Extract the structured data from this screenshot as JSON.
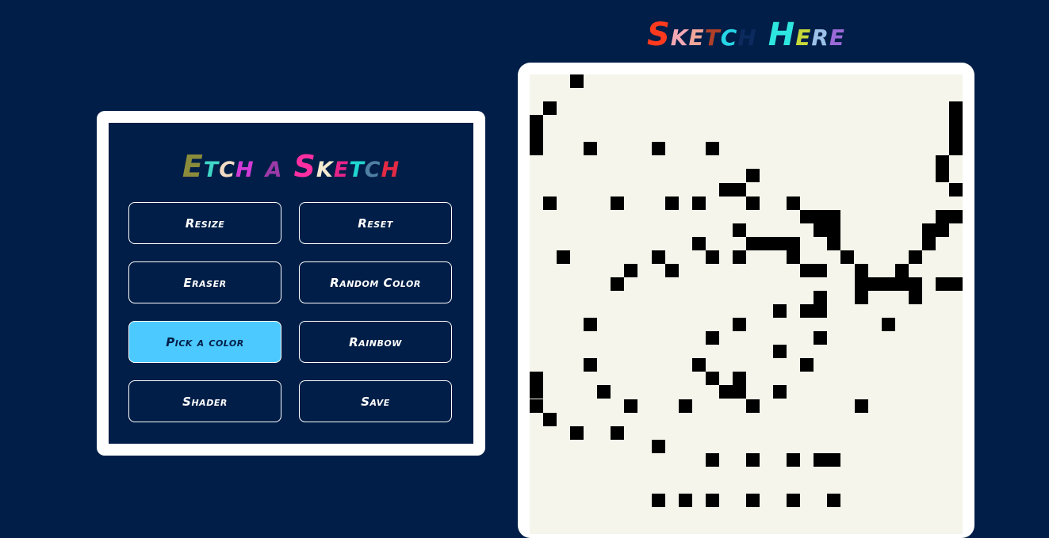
{
  "panel": {
    "title_letters": [
      {
        "ch": "E",
        "color": "#8b8c3b"
      },
      {
        "ch": "t",
        "color": "#3fd6c8"
      },
      {
        "ch": "c",
        "color": "#f2dcc4"
      },
      {
        "ch": "h",
        "color": "#d13ad6"
      },
      {
        "ch": " ",
        "color": "#ffffff"
      },
      {
        "ch": "a",
        "color": "#9b3aa8"
      },
      {
        "ch": " ",
        "color": "#ffffff"
      },
      {
        "ch": "S",
        "color": "#ff2fa2"
      },
      {
        "ch": "k",
        "color": "#f4ead0"
      },
      {
        "ch": "e",
        "color": "#e8238a"
      },
      {
        "ch": "t",
        "color": "#20d6d0"
      },
      {
        "ch": "c",
        "color": "#4f7fa4"
      },
      {
        "ch": "h",
        "color": "#e52a45"
      }
    ],
    "buttons": {
      "resize": "Resize",
      "reset": "Reset",
      "eraser": "Eraser",
      "random_color": "Random Color",
      "pick_color": "Pick a color",
      "rainbow": "Rainbow",
      "shader": "Shader",
      "save": "Save"
    },
    "active_button": "pick_color",
    "active_color": "#4cc9fe"
  },
  "sketch": {
    "title_letters": [
      {
        "ch": "S",
        "color": "#ff3a1f"
      },
      {
        "ch": "k",
        "color": "#f4a8b4"
      },
      {
        "ch": "e",
        "color": "#f2a59a"
      },
      {
        "ch": "t",
        "color": "#b0402a"
      },
      {
        "ch": "c",
        "color": "#27d6e6"
      },
      {
        "ch": "h",
        "color": "#0d2a5e"
      },
      {
        "ch": " ",
        "color": "#ffffff"
      },
      {
        "ch": "H",
        "color": "#2ee6e0"
      },
      {
        "ch": "e",
        "color": "#c6d93a"
      },
      {
        "ch": "r",
        "color": "#9bc1e8"
      },
      {
        "ch": "e",
        "color": "#9b6ad8"
      }
    ],
    "pixel_color": "#000000",
    "canvas_color": "#f5f5eb",
    "filled_cells": [
      [
        3,
        0
      ],
      [
        1,
        2
      ],
      [
        31,
        2
      ],
      [
        0,
        3
      ],
      [
        31,
        3
      ],
      [
        0,
        4
      ],
      [
        4,
        5
      ],
      [
        9,
        5
      ],
      [
        13,
        5
      ],
      [
        31,
        5
      ],
      [
        0,
        5
      ],
      [
        31,
        4
      ],
      [
        30,
        6
      ],
      [
        16,
        7
      ],
      [
        30,
        7
      ],
      [
        14,
        8
      ],
      [
        15,
        8
      ],
      [
        31,
        8
      ],
      [
        1,
        9
      ],
      [
        6,
        9
      ],
      [
        10,
        9
      ],
      [
        12,
        9
      ],
      [
        16,
        9
      ],
      [
        19,
        9
      ],
      [
        20,
        10
      ],
      [
        21,
        10
      ],
      [
        22,
        10
      ],
      [
        30,
        10
      ],
      [
        31,
        10
      ],
      [
        15,
        11
      ],
      [
        21,
        11
      ],
      [
        22,
        11
      ],
      [
        29,
        11
      ],
      [
        30,
        11
      ],
      [
        12,
        12
      ],
      [
        16,
        12
      ],
      [
        17,
        12
      ],
      [
        18,
        12
      ],
      [
        19,
        12
      ],
      [
        22,
        12
      ],
      [
        29,
        12
      ],
      [
        2,
        13
      ],
      [
        9,
        13
      ],
      [
        13,
        13
      ],
      [
        15,
        13
      ],
      [
        19,
        13
      ],
      [
        23,
        13
      ],
      [
        28,
        13
      ],
      [
        7,
        14
      ],
      [
        10,
        14
      ],
      [
        20,
        14
      ],
      [
        21,
        14
      ],
      [
        24,
        14
      ],
      [
        27,
        14
      ],
      [
        6,
        15
      ],
      [
        24,
        15
      ],
      [
        25,
        15
      ],
      [
        26,
        15
      ],
      [
        27,
        15
      ],
      [
        28,
        15
      ],
      [
        30,
        15
      ],
      [
        31,
        15
      ],
      [
        21,
        16
      ],
      [
        24,
        16
      ],
      [
        28,
        16
      ],
      [
        18,
        17
      ],
      [
        20,
        17
      ],
      [
        21,
        17
      ],
      [
        4,
        18
      ],
      [
        15,
        18
      ],
      [
        26,
        18
      ],
      [
        13,
        19
      ],
      [
        21,
        19
      ],
      [
        18,
        20
      ],
      [
        4,
        21
      ],
      [
        12,
        21
      ],
      [
        20,
        21
      ],
      [
        0,
        22
      ],
      [
        13,
        22
      ],
      [
        15,
        22
      ],
      [
        0,
        23
      ],
      [
        5,
        23
      ],
      [
        14,
        23
      ],
      [
        15,
        23
      ],
      [
        18,
        23
      ],
      [
        0,
        24
      ],
      [
        7,
        24
      ],
      [
        11,
        24
      ],
      [
        16,
        24
      ],
      [
        24,
        24
      ],
      [
        1,
        25
      ],
      [
        3,
        26
      ],
      [
        6,
        26
      ],
      [
        9,
        27
      ],
      [
        13,
        28
      ],
      [
        16,
        28
      ],
      [
        19,
        28
      ],
      [
        21,
        28
      ],
      [
        22,
        28
      ],
      [
        9,
        31
      ],
      [
        11,
        31
      ],
      [
        13,
        31
      ],
      [
        16,
        31
      ],
      [
        19,
        31
      ],
      [
        22,
        31
      ]
    ]
  }
}
